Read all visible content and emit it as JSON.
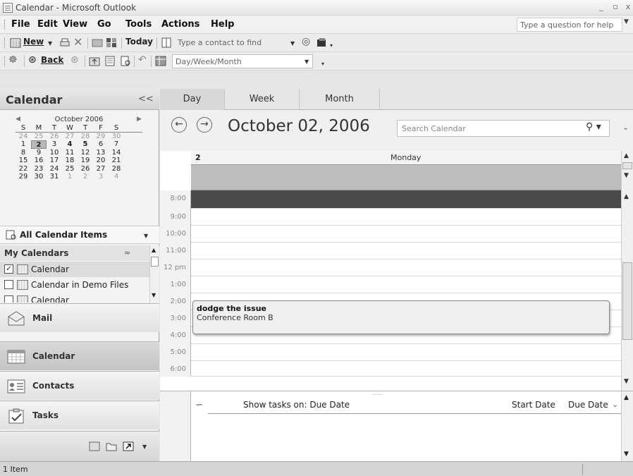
{
  "window": {
    "title": "Calendar - Microsoft Outlook",
    "controls": [
      "_",
      "▫",
      "x"
    ]
  },
  "menu": {
    "items": [
      "File",
      "Edit",
      "View",
      "Go",
      "Tools",
      "Actions",
      "Help"
    ],
    "help_placeholder": "Type a question for help"
  },
  "toolbar1": {
    "new_label": "New",
    "today_label": "Today",
    "contact_placeholder": "Type a contact to find"
  },
  "toolbar2": {
    "back_label": "Back",
    "view_select": "Day/Week/Month"
  },
  "leftpane": {
    "title": "Calendar",
    "collapse": "<<",
    "minical": {
      "month": "October 2006",
      "dow": [
        "S",
        "M",
        "T",
        "W",
        "T",
        "F",
        "S"
      ],
      "weeks": [
        [
          "24",
          "25",
          "26",
          "27",
          "28",
          "29",
          "30"
        ],
        [
          "1",
          "2",
          "3",
          "4",
          "5",
          "6",
          "7"
        ],
        [
          "8",
          "9",
          "10",
          "11",
          "12",
          "13",
          "14"
        ],
        [
          "15",
          "16",
          "17",
          "18",
          "19",
          "20",
          "21"
        ],
        [
          "22",
          "23",
          "24",
          "25",
          "26",
          "27",
          "28"
        ],
        [
          "29",
          "30",
          "31",
          "1",
          "2",
          "3",
          "4"
        ]
      ]
    },
    "all_items": "All Calendar Items",
    "my_calendars": "My Calendars",
    "calendars": [
      {
        "label": "Calendar",
        "checked": true
      },
      {
        "label": "Calendar in Demo Files",
        "checked": false
      },
      {
        "label": "Calendar",
        "checked": false
      }
    ],
    "nav": [
      "Mail",
      "Calendar",
      "Contacts",
      "Tasks"
    ]
  },
  "main": {
    "tabs": [
      "Day",
      "Week",
      "Month"
    ],
    "date_title": "October 02, 2006",
    "search_placeholder": "Search Calendar",
    "day_number": "2",
    "day_name": "Monday",
    "times": [
      "8:00",
      "9:00",
      "10:00",
      "11:00",
      "12 pm",
      "1:00",
      "2:00",
      "3:00",
      "4:00",
      "5:00",
      "6:00"
    ],
    "appointment": {
      "subject": "dodge the issue",
      "location": "Conference Room B",
      "start": "2:00",
      "end": "4:00"
    },
    "tasks": {
      "show_label": "Show tasks on: Due Date",
      "start_col": "Start Date",
      "due_col": "Due Date"
    }
  },
  "status": {
    "text": "1 Item"
  }
}
